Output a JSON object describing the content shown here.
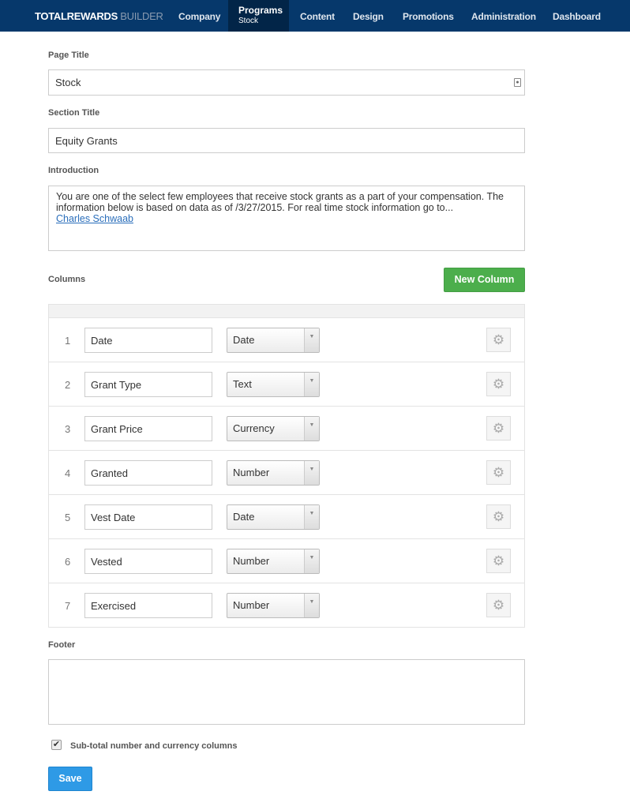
{
  "nav": {
    "brand_main": "TOTALREWARDS",
    "brand_sub": "BUILDER",
    "items": [
      "Company",
      "Content",
      "Design",
      "Promotions",
      "Administration",
      "Dashboard"
    ],
    "active": {
      "label": "Programs",
      "sub": "Stock"
    }
  },
  "form": {
    "page_title_label": "Page Title",
    "page_title_value": "Stock",
    "section_title_label": "Section Title",
    "section_title_value": "Equity Grants",
    "introduction_label": "Introduction",
    "introduction_text": "You are one of the select few employees that receive stock grants as a part of your compensation. The information below is based on data as of /3/27/2015. For real time stock information go to...",
    "introduction_link": "Charles Schwaab",
    "columns_label": "Columns",
    "new_column_label": "New Column",
    "columns": [
      {
        "num": "1",
        "name": "Date",
        "type": "Date"
      },
      {
        "num": "2",
        "name": "Grant Type",
        "type": "Text"
      },
      {
        "num": "3",
        "name": "Grant Price",
        "type": "Currency"
      },
      {
        "num": "4",
        "name": "Granted",
        "type": "Number"
      },
      {
        "num": "5",
        "name": "Vest Date",
        "type": "Date"
      },
      {
        "num": "6",
        "name": "Vested",
        "type": "Number"
      },
      {
        "num": "7",
        "name": "Exercised",
        "type": "Number"
      }
    ],
    "footer_label": "Footer",
    "footer_value": "",
    "subtotal_label": "Sub-total number and currency columns",
    "subtotal_checked": true,
    "save_label": "Save"
  }
}
